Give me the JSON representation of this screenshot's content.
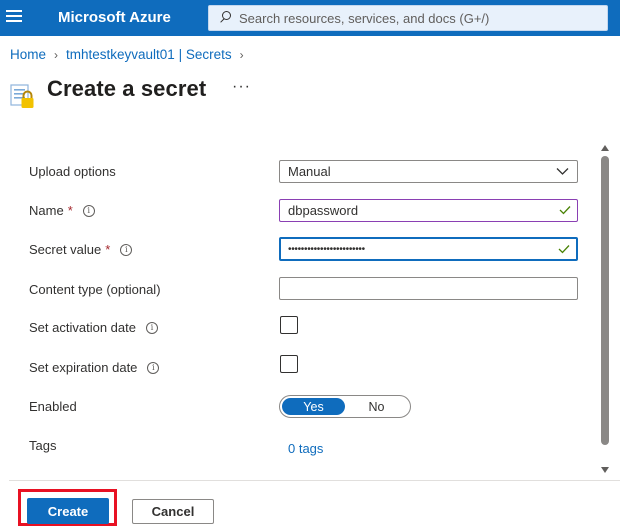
{
  "header": {
    "brand": "Microsoft Azure",
    "search_placeholder": "Search resources, services, and docs (G+/)",
    "accent_color": "#0f6cbd"
  },
  "breadcrumb": [
    {
      "label": "Home"
    },
    {
      "label": "tmhtestkeyvault01 | Secrets"
    }
  ],
  "page": {
    "title": "Create a secret",
    "more_label": "···",
    "icon": "key-vault-secret-icon"
  },
  "form": {
    "upload_options": {
      "label": "Upload options",
      "value": "Manual"
    },
    "name": {
      "label": "Name",
      "required_mark": "*",
      "value": "dbpassword"
    },
    "secret_value": {
      "label": "Secret value",
      "required_mark": "*",
      "value": "••••••••••••••••••••••••"
    },
    "content_type": {
      "label": "Content type (optional)",
      "value": ""
    },
    "activation_date": {
      "label": "Set activation date",
      "checked": false
    },
    "expiration_date": {
      "label": "Set expiration date",
      "checked": false
    },
    "enabled": {
      "label": "Enabled",
      "options": [
        "Yes",
        "No"
      ],
      "selected": "Yes"
    },
    "tags": {
      "label": "Tags",
      "link": "0 tags"
    },
    "info_glyph": "i"
  },
  "footer": {
    "create_label": "Create",
    "cancel_label": "Cancel",
    "highlight_color": "#e81123"
  }
}
